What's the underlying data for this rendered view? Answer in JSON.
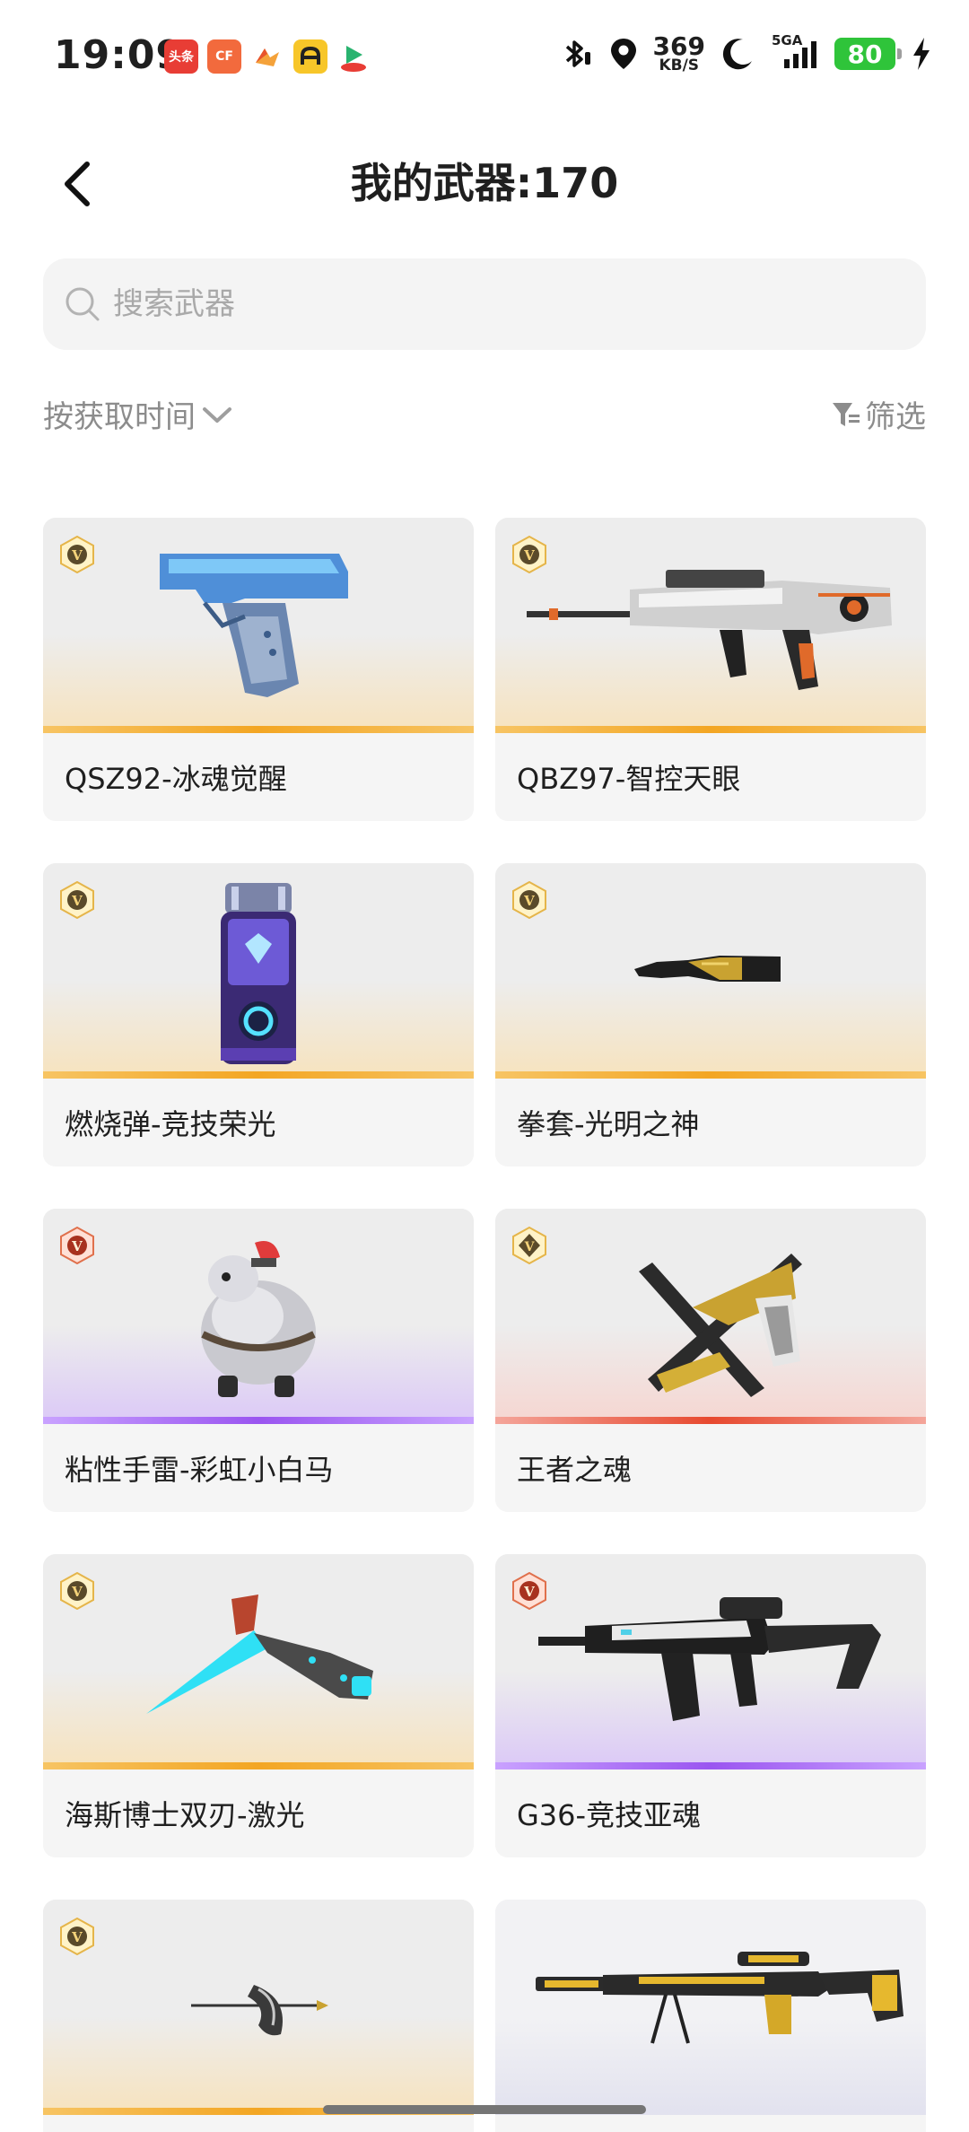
{
  "status_bar": {
    "time": "19:09",
    "app_icons": [
      {
        "name": "toutiao-icon",
        "label": "头条",
        "color": "#e83d35"
      },
      {
        "name": "cf-game-icon",
        "label": "CF",
        "color": "#f26a3d"
      },
      {
        "name": "game-app-icon",
        "label": "",
        "color": "#f4a23a"
      },
      {
        "name": "a-app-icon",
        "label": "A",
        "color": "#f7c629"
      },
      {
        "name": "video-app-icon",
        "label": "",
        "color": "#29b36f"
      }
    ],
    "net_speed_value": "369",
    "net_speed_unit": "KB/S",
    "signal_label": "5GA",
    "battery": "80"
  },
  "header": {
    "title": "我的武器:170"
  },
  "search": {
    "placeholder": "搜索武器"
  },
  "toolbar": {
    "sort_label": "按获取时间",
    "filter_label": "筛选"
  },
  "colors": {
    "gold": "#f3a623",
    "purple": "#9a55f0",
    "red": "#e7492f"
  },
  "weapons": [
    {
      "name": "QSZ92-冰魂觉醒",
      "rarity": "gold"
    },
    {
      "name": "QBZ97-智控天眼",
      "rarity": "gold"
    },
    {
      "name": "燃烧弹-竞技荣光",
      "rarity": "gold"
    },
    {
      "name": "拳套-光明之神",
      "rarity": "gold"
    },
    {
      "name": "粘性手雷-彩虹小白马",
      "rarity": "purple"
    },
    {
      "name": "王者之魂",
      "rarity": "red"
    },
    {
      "name": "海斯博士双刃-激光",
      "rarity": "gold"
    },
    {
      "name": "G36-竞技亚魂",
      "rarity": "purple"
    },
    {
      "name": "",
      "rarity": "gold"
    },
    {
      "name": "",
      "rarity": "pale"
    }
  ]
}
